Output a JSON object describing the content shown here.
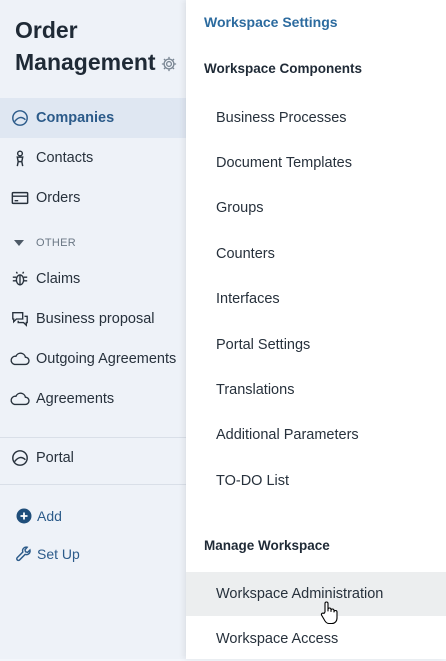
{
  "app": {
    "title": "Order Management"
  },
  "sidebar": {
    "items": [
      {
        "label": "Companies",
        "icon": "companies-icon",
        "active": true
      },
      {
        "label": "Contacts",
        "icon": "contacts-icon"
      },
      {
        "label": "Orders",
        "icon": "orders-icon"
      }
    ],
    "section": "OTHER",
    "other_items": [
      {
        "label": "Claims",
        "icon": "claims-icon"
      },
      {
        "label": "Business proposal",
        "icon": "chat-icon"
      },
      {
        "label": "Outgoing Agreements",
        "icon": "cloud-icon"
      },
      {
        "label": "Agreements",
        "icon": "cloud-icon"
      }
    ],
    "portal": {
      "label": "Portal",
      "icon": "portal-icon"
    },
    "add_label": "Add",
    "setup_label": "Set Up"
  },
  "menu": {
    "settings_link": "Workspace Settings",
    "components_header": "Workspace Components",
    "components": [
      "Business Processes",
      "Document Templates",
      "Groups",
      "Counters",
      "Interfaces",
      "Portal Settings",
      "Translations",
      "Additional Parameters",
      "TO-DO List"
    ],
    "manage_header": "Manage Workspace",
    "manage": [
      {
        "label": "Workspace Administration",
        "hovered": true
      },
      {
        "label": "Workspace Access"
      }
    ]
  },
  "colors": {
    "accent": "#2c6b9f",
    "active_bg": "#dfe7f2",
    "hover_bg": "#eceeef"
  }
}
